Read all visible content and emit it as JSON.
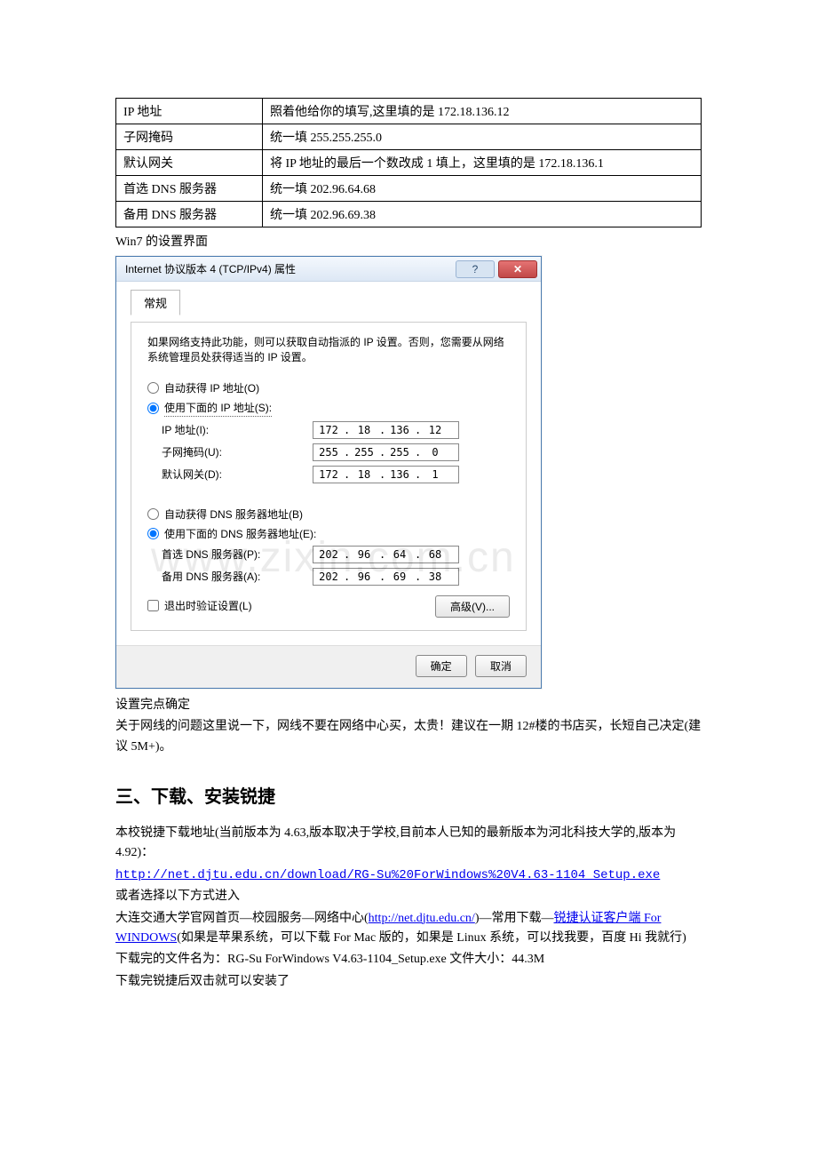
{
  "table": {
    "rows": [
      {
        "k": "IP 地址",
        "v": "照着他给你的填写,这里填的是 172.18.136.12"
      },
      {
        "k": "子网掩码",
        "v": "统一填 255.255.255.0"
      },
      {
        "k": "默认网关",
        "v": "将 IP 地址的最后一个数改成 1 填上，这里填的是 172.18.136.1"
      },
      {
        "k": "首选 DNS 服务器",
        "v": "统一填 202.96.64.68"
      },
      {
        "k": "备用 DNS 服务器",
        "v": "统一填 202.96.69.38"
      }
    ]
  },
  "caption_win7": "Win7 的设置界面",
  "dialog": {
    "title": "Internet 协议版本 4 (TCP/IPv4) 属性",
    "help": "?",
    "close": "✕",
    "tab": "常规",
    "desc": "如果网络支持此功能，则可以获取自动指派的 IP 设置。否则，您需要从网络系统管理员处获得适当的 IP 设置。",
    "auto_ip": "自动获得 IP 地址(O)",
    "manual_ip": "使用下面的 IP 地址(S):",
    "ip_label": "IP 地址(I):",
    "mask_label": "子网掩码(U):",
    "gw_label": "默认网关(D):",
    "ip": [
      "172",
      "18",
      "136",
      "12"
    ],
    "mask": [
      "255",
      "255",
      "255",
      "0"
    ],
    "gw": [
      "172",
      "18",
      "136",
      "1"
    ],
    "auto_dns": "自动获得 DNS 服务器地址(B)",
    "manual_dns": "使用下面的 DNS 服务器地址(E):",
    "dns1_label": "首选 DNS 服务器(P):",
    "dns2_label": "备用 DNS 服务器(A):",
    "dns1": [
      "202",
      "96",
      "64",
      "68"
    ],
    "dns2": [
      "202",
      "96",
      "69",
      "38"
    ],
    "validate": "退出时验证设置(L)",
    "advanced": "高级(V)...",
    "ok": "确定",
    "cancel": "取消"
  },
  "after_dialog": {
    "l1": "设置完点确定",
    "l2": "关于网线的问题这里说一下，网线不要在网络中心买，太贵！建议在一期 12#楼的书店买，长短自己决定(建议 5M+)。"
  },
  "section3": {
    "heading": "三、下载、安装锐捷",
    "p1": "本校锐捷下载地址(当前版本为 4.63,版本取决于学校,目前本人已知的最新版本为河北科技大学的,版本为 4.92)：",
    "link1": "http://net.djtu.edu.cn/download/RG-Su%20ForWindows%20V4.63-1104_Setup.exe",
    "p2": "或者选择以下方式进入",
    "p3a": "大连交通大学官网首页—校园服务—网络中心(",
    "link2": "http://net.djtu.edu.cn/",
    "p3b": ")—常用下载—",
    "link3": "锐捷认证客户端 For WINDOWS",
    "p3c": "(如果是苹果系统，可以下载 For Mac 版的，如果是 Linux 系统，可以找我要，百度 Hi 我就行)",
    "p4": "下载完的文件名为：RG-Su ForWindows V4.63-1104_Setup.exe  文件大小：44.3M",
    "p5": "下载完锐捷后双击就可以安装了"
  },
  "watermark": "www.zixin.com.cn"
}
